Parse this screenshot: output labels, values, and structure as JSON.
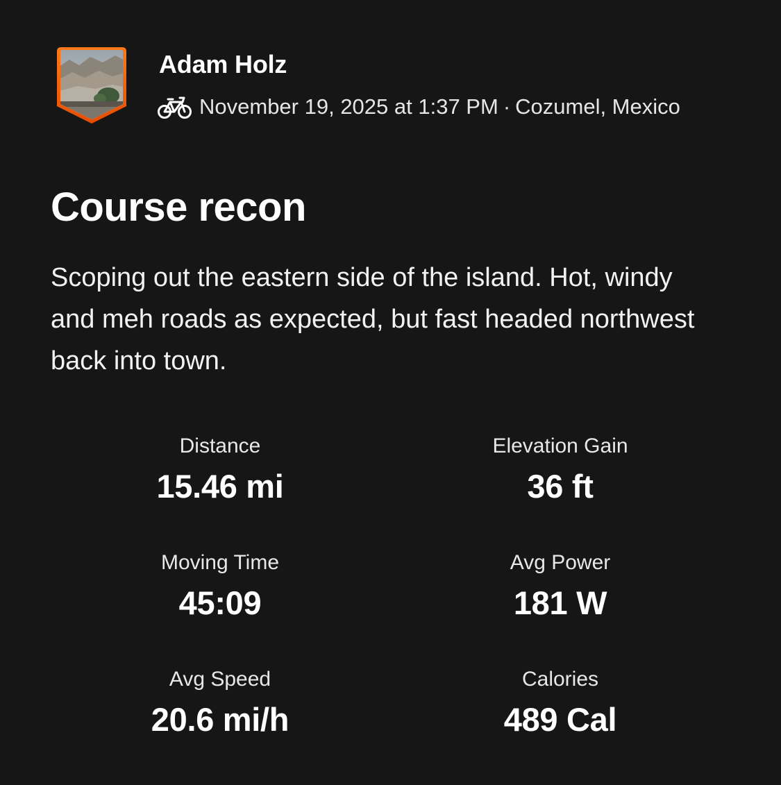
{
  "athlete": {
    "name": "Adam Holz",
    "avatar_icon": "profile-photo-badge",
    "badge_color": "#fc5200"
  },
  "activity": {
    "sport_icon": "bike-icon",
    "date": "November 19, 2025 at 1:37 PM",
    "separator": "·",
    "location": "Cozumel, Mexico",
    "title": "Course recon",
    "description": "Scoping out the eastern side of the island. Hot, windy and meh roads as expected, but fast headed northwest back into town."
  },
  "stats": {
    "distance": {
      "label": "Distance",
      "value": "15.46 mi"
    },
    "elevation_gain": {
      "label": "Elevation Gain",
      "value": "36 ft"
    },
    "moving_time": {
      "label": "Moving Time",
      "value": "45:09"
    },
    "avg_power": {
      "label": "Avg Power",
      "value": "181 W"
    },
    "avg_speed": {
      "label": "Avg Speed",
      "value": "20.6 mi/h"
    },
    "calories": {
      "label": "Calories",
      "value": "489 Cal"
    }
  }
}
